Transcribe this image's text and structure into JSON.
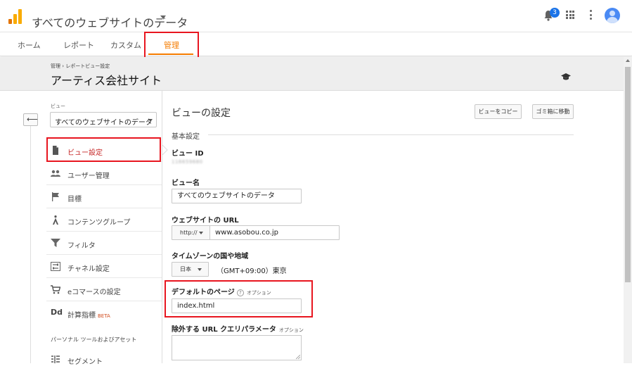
{
  "header": {
    "account_title": "すべてのウェブサイトのデータ",
    "notification_count": "3",
    "icons": [
      "analytics-logo-icon",
      "bell-icon",
      "apps-grid-icon",
      "more-vert-icon",
      "account-avatar-icon"
    ]
  },
  "tabs": [
    {
      "label": "ホーム"
    },
    {
      "label": "レポート"
    },
    {
      "label": "カスタム"
    },
    {
      "label": "管理"
    }
  ],
  "page": {
    "breadcrumb": "管理 › レポートビュー設定",
    "property_title": "アーティス会社サイト"
  },
  "sidebar": {
    "view_label": "ビュー",
    "view_selected": "すべてのウェブサイトのデータ",
    "items": [
      {
        "label": "ビュー設定",
        "icon": "document-icon"
      },
      {
        "label": "ユーザー管理",
        "icon": "people-icon"
      },
      {
        "label": "目標",
        "icon": "flag-icon"
      },
      {
        "label": "コンテンツグループ",
        "icon": "walking-person-icon"
      },
      {
        "label": "フィルタ",
        "icon": "filter-icon"
      },
      {
        "label": "チャネル設定",
        "icon": "channel-settings-icon"
      },
      {
        "label": "eコマースの設定",
        "icon": "shopping-cart-icon"
      },
      {
        "label": "計算指標",
        "badge": "BETA",
        "icon": "dd-icon"
      },
      {
        "label": "セグメント",
        "icon": "segment-icon"
      }
    ],
    "section_personal": "パーソナル ツールおよびアセット"
  },
  "main": {
    "title": "ビューの設定",
    "copy_button": "ビューをコピー",
    "trash_button": "ゴミ箱に移動",
    "basic_section": "基本設定",
    "view_id_label": "ビュー ID",
    "view_id_value": "116659680",
    "view_name_label": "ビュー名",
    "view_name_value": "すべてのウェブサイトのデータ",
    "url_label": "ウェブサイトの URL",
    "protocol_value": "http://",
    "url_value": "www.asobou.co.jp",
    "timezone_label": "タイムゾーンの国や地域",
    "country_value": "日本",
    "timezone_value": "（GMT+09:00）東京",
    "default_page_label": "デフォルトのページ",
    "optional_text": "オプション",
    "default_page_value": "index.html",
    "exclude_params_label": "除外する URL クエリパラメータ",
    "exclude_params_value": ""
  },
  "colors": {
    "accent": "#f57c00",
    "highlight": "#e8151f",
    "active_nav": "#c62828",
    "badge": "#1a73e8"
  }
}
